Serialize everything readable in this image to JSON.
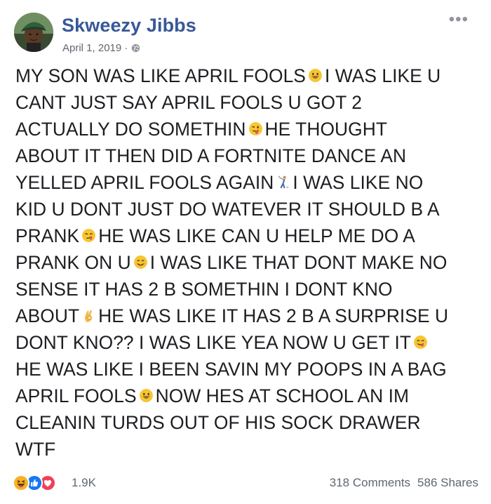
{
  "post": {
    "author": "Skweezy Jibbs",
    "date": "April 1, 2019",
    "separator": "·",
    "privacy_icon": "globe-icon",
    "more_icon": "more-options-icon",
    "more_glyph": "•••",
    "lines": [
      [
        "MY SON WAS LIKE APRIL FOOLS",
        "I WAS LIKE U"
      ],
      [
        "CANT JUST SAY APRIL FOOLS U GOT 2"
      ],
      [
        "ACTUALLY DO SOMETHIN",
        "HE THOUGHT"
      ],
      [
        "ABOUT IT THEN DID A FORTNITE DANCE AN"
      ],
      [
        "YELLED APRIL FOOLS AGAIN",
        "I WAS LIKE NO"
      ],
      [
        "KID U DONT JUST DO WATEVER IT SHOULD B A"
      ],
      [
        "PRANK",
        "HE WAS LIKE CAN U HELP ME DO A"
      ],
      [
        "PRANK ON U",
        "I WAS LIKE THAT DONT MAKE NO"
      ],
      [
        "SENSE IT HAS 2 B SOMETHIN I DONT KNO"
      ],
      [
        "ABOUT",
        "HE WAS LIKE IT HAS 2 B A SURPRISE U"
      ],
      [
        "DONT KNO?? I WAS LIKE YEA NOW U GET IT"
      ],
      [
        "HE WAS LIKE I BEEN SAVIN MY POOPS IN A BAG"
      ],
      [
        "APRIL FOOLS",
        "NOW HES AT SCHOOL AN IM"
      ],
      [
        "CLEANIN TURDS OUT OF HIS SOCK DRAWER"
      ],
      [
        "WTF"
      ]
    ],
    "emojis": [
      "grinning-face-emoji",
      "winking-tongue-emoji",
      "golfer-emoji",
      "smirking-face-emoji",
      "smiling-face-emoji",
      "ok-hand-emoji",
      "yum-face-emoji",
      "grinning-face-emoji"
    ]
  },
  "footer": {
    "reactions": [
      "haha-reaction-icon",
      "like-reaction-icon",
      "love-reaction-icon"
    ],
    "reaction_count": "1.9K",
    "comments": "318 Comments",
    "shares": "586 Shares"
  },
  "colors": {
    "author_link": "#385898",
    "meta_text": "#606770",
    "body_text": "#1c1e21",
    "like_blue": "#1877f2",
    "love_red": "#f33e58",
    "haha_yellow": "#f7b125"
  }
}
